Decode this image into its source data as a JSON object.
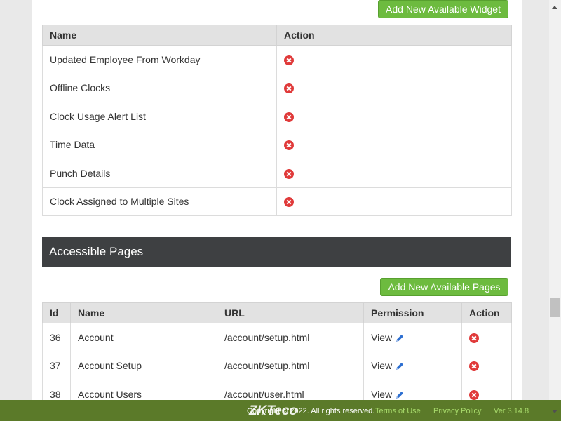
{
  "widgets": {
    "add_button": "Add New Available Widget",
    "headers": [
      "Name",
      "Action"
    ],
    "rows": [
      {
        "name": "Updated Employee From Workday"
      },
      {
        "name": "Offline Clocks"
      },
      {
        "name": "Clock Usage Alert List"
      },
      {
        "name": "Time Data"
      },
      {
        "name": "Punch Details"
      },
      {
        "name": "Clock Assigned to Multiple Sites"
      }
    ]
  },
  "pages": {
    "title": "Accessible Pages",
    "add_button": "Add New Available Pages",
    "headers": [
      "Id",
      "Name",
      "URL",
      "Permission",
      "Action"
    ],
    "rows": [
      {
        "id": "36",
        "name": "Account",
        "url": "/account/setup.html",
        "permission": "View"
      },
      {
        "id": "37",
        "name": "Account Setup",
        "url": "/account/setup.html",
        "permission": "View"
      },
      {
        "id": "38",
        "name": "Account Users",
        "url": "/account/user.html",
        "permission": "View"
      }
    ]
  },
  "footer": {
    "logo": "ZKTeco",
    "copyright": "Copyright © 2022. All rights reserved.",
    "terms": "Terms of Use",
    "privacy": "Privacy Policy",
    "version": "Ver 3.14.8",
    "sep": "|"
  },
  "colors": {
    "accent": "#6dbb3f",
    "danger": "#e03a3a",
    "header_dark": "#3e4042",
    "footer": "#5b7a29",
    "edit": "#2d6fd1"
  }
}
